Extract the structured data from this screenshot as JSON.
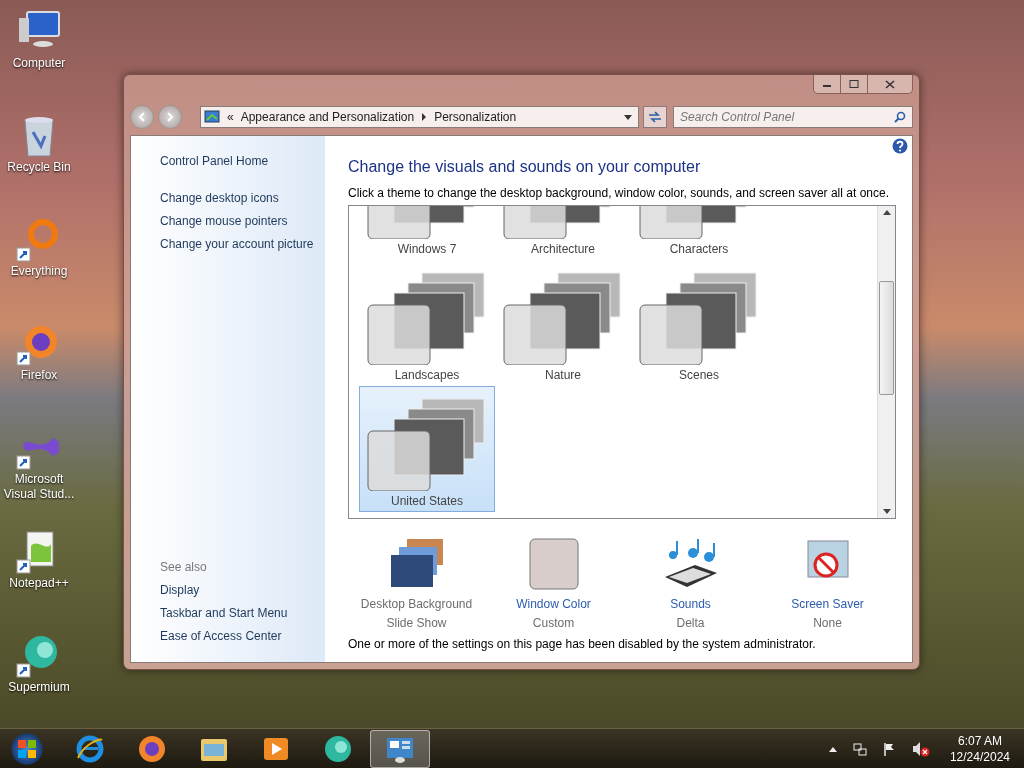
{
  "desktop_icons": [
    {
      "label": "Computer",
      "kind": "computer",
      "shortcut": false
    },
    {
      "label": "Recycle Bin",
      "kind": "recycle",
      "shortcut": false
    },
    {
      "label": "Everything",
      "kind": "everything",
      "shortcut": true
    },
    {
      "label": "Firefox",
      "kind": "firefox",
      "shortcut": true
    },
    {
      "label": "Microsoft Visual Stud...",
      "kind": "vs",
      "shortcut": true
    },
    {
      "label": "Notepad++",
      "kind": "notepad",
      "shortcut": true
    },
    {
      "label": "Supermium",
      "kind": "supermium",
      "shortcut": true
    }
  ],
  "window": {
    "address": {
      "overflow": "«",
      "crumbs": [
        "Appearance and Personalization",
        "Personalization"
      ]
    },
    "search": {
      "placeholder": "Search Control Panel"
    },
    "sidebar": {
      "home": "Control Panel Home",
      "links": [
        "Change desktop icons",
        "Change mouse pointers",
        "Change your account picture"
      ],
      "see_also": {
        "heading": "See also",
        "links": [
          "Display",
          "Taskbar and Start Menu",
          "Ease of Access Center"
        ]
      }
    },
    "heading": "Change the visuals and sounds on your computer",
    "instruction": "Click a theme to change the desktop background, window color, sounds, and screen saver all at once.",
    "themes": [
      {
        "name": "Windows 7",
        "selected": false
      },
      {
        "name": "Architecture",
        "selected": false
      },
      {
        "name": "Characters",
        "selected": false
      },
      {
        "name": "Landscapes",
        "selected": false
      },
      {
        "name": "Nature",
        "selected": false
      },
      {
        "name": "Scenes",
        "selected": false
      },
      {
        "name": "United States",
        "selected": true
      }
    ],
    "settings": [
      {
        "kind": "background",
        "label": "Desktop Background",
        "value": "Slide Show",
        "disabled": true
      },
      {
        "kind": "color",
        "label": "Window Color",
        "value": "Custom",
        "disabled": false
      },
      {
        "kind": "sounds",
        "label": "Sounds",
        "value": "Delta",
        "disabled": false
      },
      {
        "kind": "screensaver",
        "label": "Screen Saver",
        "value": "None",
        "disabled": false
      }
    ],
    "notice": "One or more of the settings on this page has been disabled by the system administrator."
  },
  "taskbar": {
    "items": [
      {
        "kind": "ie",
        "selected": false
      },
      {
        "kind": "firefox",
        "selected": false
      },
      {
        "kind": "explorer",
        "selected": false
      },
      {
        "kind": "media",
        "selected": false
      },
      {
        "kind": "supermium",
        "selected": false
      },
      {
        "kind": "controlpanel",
        "selected": true
      }
    ],
    "time": "6:07 AM",
    "date": "12/24/2024"
  }
}
